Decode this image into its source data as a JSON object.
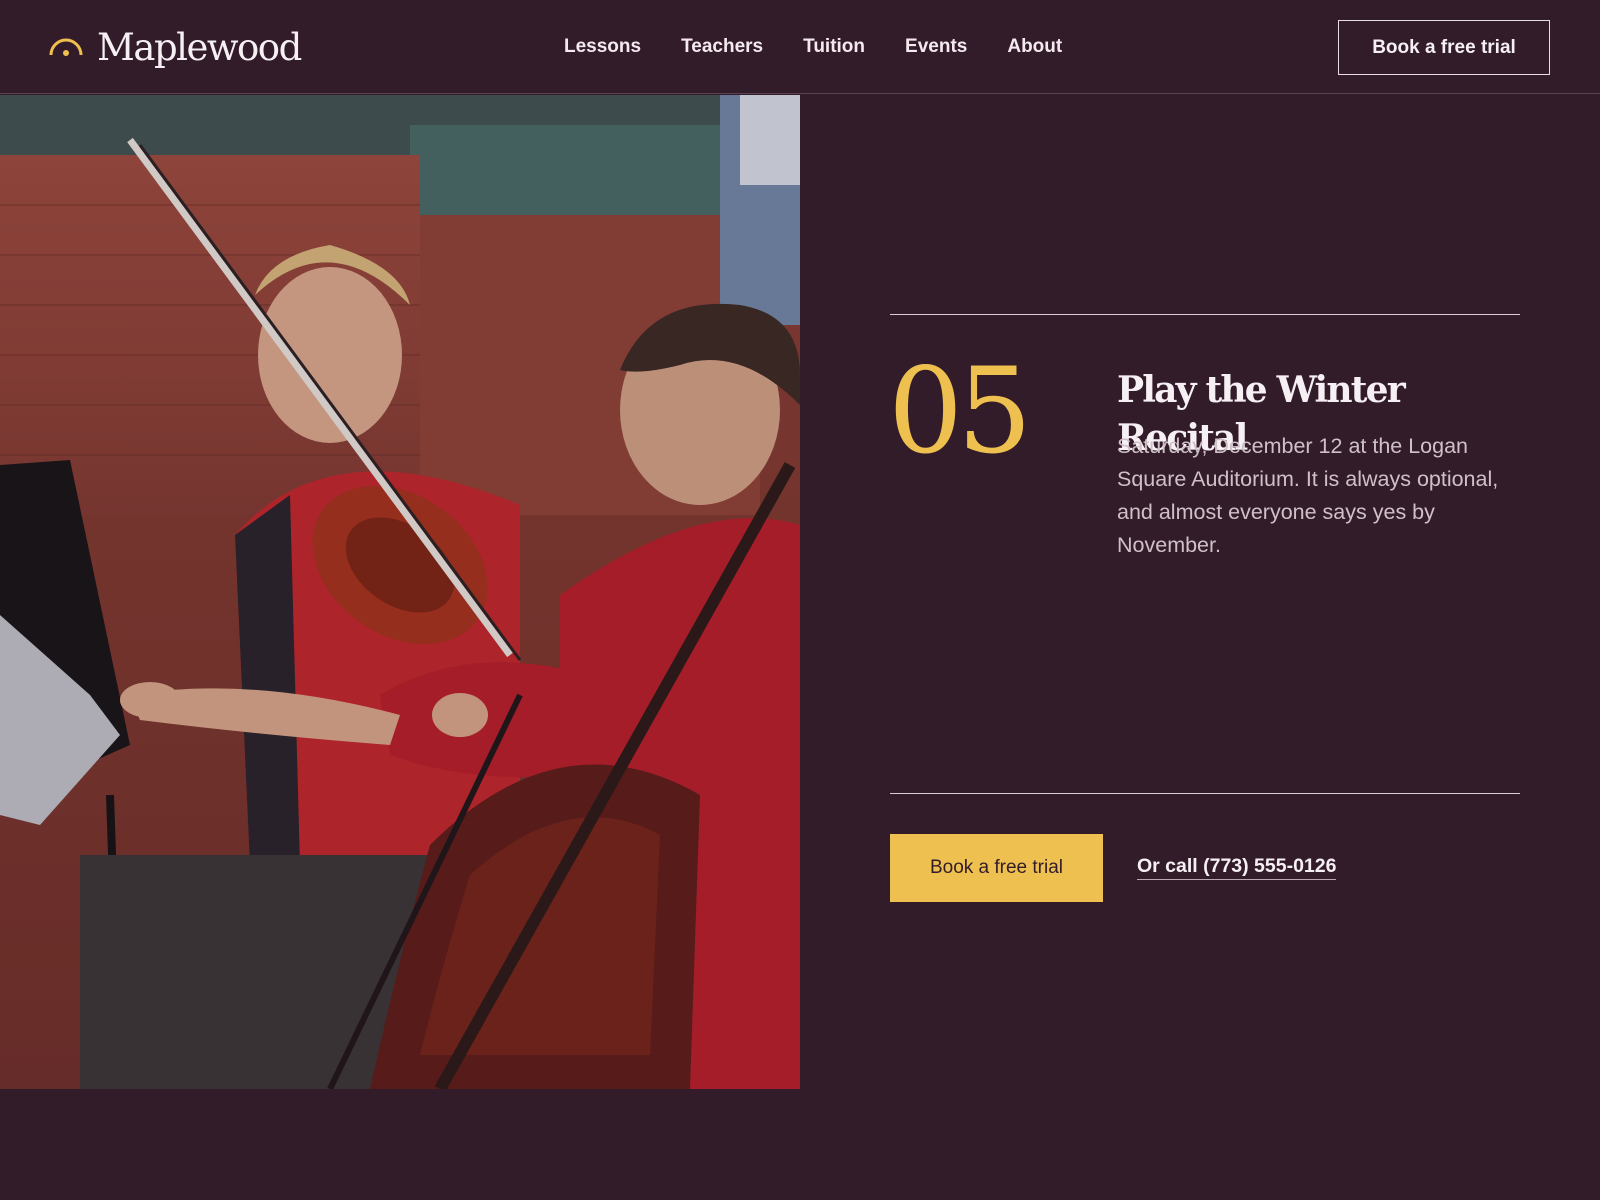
{
  "brand": {
    "name": "Maplewood",
    "accent_color": "#eec04f",
    "logo_icon": "sun-arc-icon"
  },
  "nav": {
    "items": [
      {
        "label": "Lessons"
      },
      {
        "label": "Teachers"
      },
      {
        "label": "Tuition"
      },
      {
        "label": "Events"
      },
      {
        "label": "About"
      }
    ]
  },
  "header": {
    "cta_label": "Book a free trial"
  },
  "hero": {
    "image": "photo-two-kids-violin-and-cello"
  },
  "step": {
    "number": "05",
    "title": "Play the Winter Recital",
    "description": "Saturday, December 12 at the Logan Square Auditorium. It is always optional, and almost everyone says yes by November."
  },
  "cta": {
    "primary_label": "Book a free trial",
    "call_label": "Or call (773) 555-0126"
  },
  "colors": {
    "background": "#331c2a",
    "accent": "#eec04f",
    "text": "#f6eff3",
    "muted_text": "#cfc0c8"
  }
}
